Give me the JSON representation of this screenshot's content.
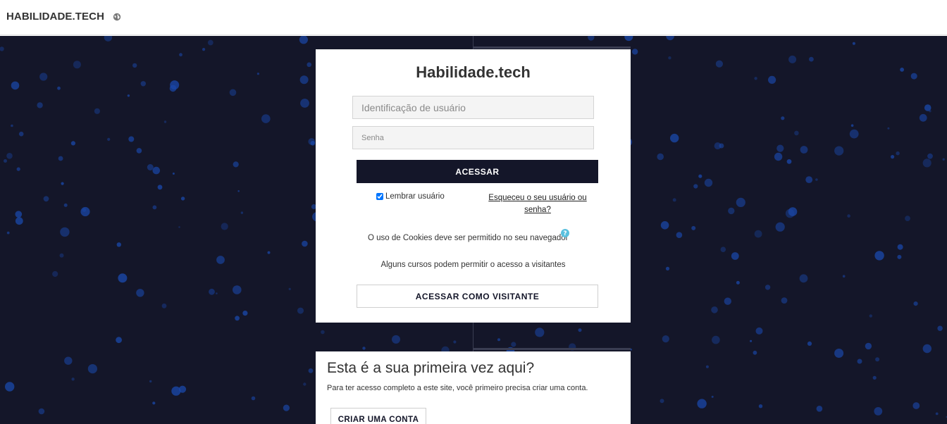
{
  "header": {
    "brand": "HABILIDADE.TECH",
    "language_icon": "globe-icon"
  },
  "login": {
    "title": "Habilidade.tech",
    "username_placeholder": "Identificação de usuário",
    "password_placeholder": "Senha",
    "login_button": "ACESSAR",
    "remember_label": "Lembrar usuário",
    "remember_checked": true,
    "forgot_link": "Esqueceu o seu usuário ou senha?",
    "cookies_notice": "O uso de Cookies deve ser permitido no seu navegador",
    "help_icon": "question-circle-icon",
    "guest_note": "Alguns cursos podem permitir o acesso a visitantes",
    "guest_button": "ACESSAR COMO VISITANTE"
  },
  "signup": {
    "title": "Esta é a sua primeira vez aqui?",
    "description": "Para ter acesso completo a este site, você primeiro precisa criar uma conta.",
    "button": "CRIAR UMA CONTA"
  },
  "colors": {
    "background": "#141629",
    "primary_button": "#141629",
    "dots": "#1a47a8",
    "help_icon": "#5bc0de"
  }
}
